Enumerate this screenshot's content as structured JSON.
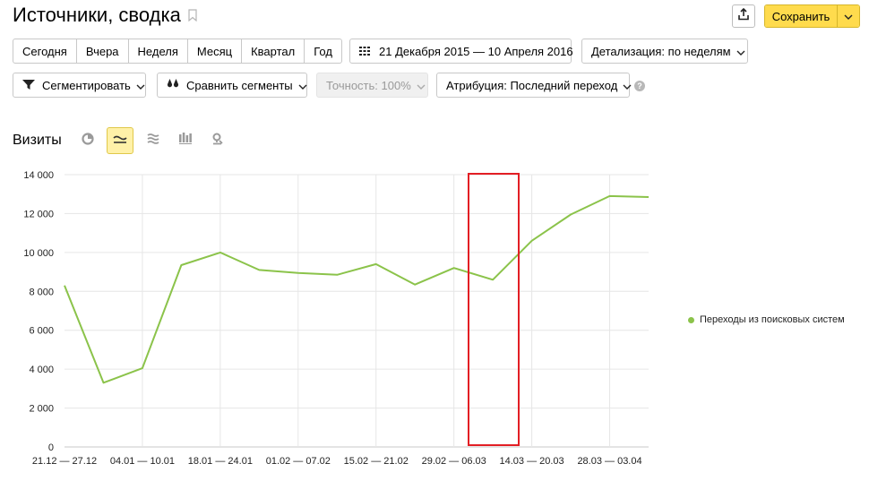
{
  "header": {
    "title": "Источники, сводка",
    "save_label": "Сохранить"
  },
  "periods": [
    "Сегодня",
    "Вчера",
    "Неделя",
    "Месяц",
    "Квартал",
    "Год"
  ],
  "date_range": "21 Декабря 2015 — 10 Апреля 2016",
  "detail": "Детализация: по неделям",
  "segment_label": "Сегментировать",
  "compare_label": "Сравнить сегменты",
  "accuracy_label": "Точность: 100%",
  "attribution_label": "Атрибуция: Последний переход",
  "help_mark": "?",
  "chart_title": "Визиты",
  "icons": [
    "pie-icon",
    "line-chart-icon",
    "area-chart-icon",
    "bar-chart-icon",
    "map-icon"
  ],
  "colors": {
    "series": "#8bc34a",
    "accent": "#ffdb4d",
    "highlight": "#e31e24"
  },
  "chart_data": {
    "type": "line",
    "title": "",
    "xlabel": "",
    "ylabel": "",
    "ylim": [
      0,
      14000
    ],
    "yticks": [
      "0",
      "2 000",
      "4 000",
      "6 000",
      "8 000",
      "10 000",
      "12 000",
      "14 000"
    ],
    "x_tick_labels": [
      "21.12 — 27.12",
      "04.01 — 10.01",
      "18.01 — 24.01",
      "01.02 — 07.02",
      "15.02 — 21.02",
      "29.02 — 06.03",
      "14.03 — 20.03",
      "28.03 — 03.04"
    ],
    "legend_position": "right",
    "series": [
      {
        "name": "Переходы из поисковых систем",
        "values": [
          8300,
          3300,
          4050,
          9350,
          10000,
          9100,
          8950,
          8850,
          9400,
          8350,
          9200,
          8600,
          10600,
          11950,
          12900,
          12850
        ]
      }
    ]
  }
}
